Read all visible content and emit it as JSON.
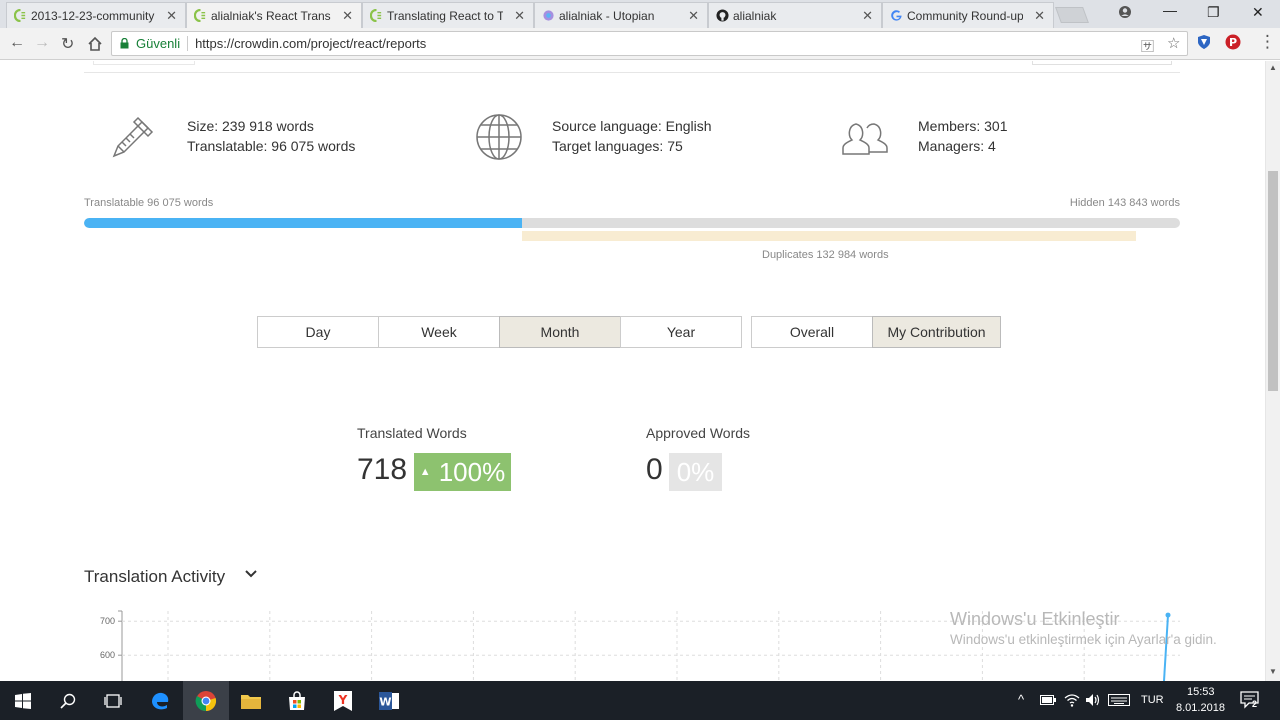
{
  "browser": {
    "tabs": [
      {
        "title": "2013-12-23-community",
        "favicon": "crowdin-icon"
      },
      {
        "title": "alialniak's React Transla",
        "favicon": "crowdin-icon",
        "active": true
      },
      {
        "title": "Translating React to Tu",
        "favicon": "crowdin-icon"
      },
      {
        "title": "alialniak - Utopian",
        "favicon": "utopian-icon"
      },
      {
        "title": "alialniak",
        "favicon": "github-icon"
      },
      {
        "title": "Community Round-up",
        "favicon": "google-icon"
      }
    ],
    "secure_label": "Güvenli",
    "url": "https://crowdin.com/project/react/reports"
  },
  "stats": {
    "size": "Size: 239 918 words",
    "translatable": "Translatable: 96 075 words",
    "source_language": "Source language: English",
    "target_languages": "Target languages: 75",
    "members": "Members: 301",
    "managers": "Managers: 4"
  },
  "progress": {
    "left_label": "Translatable 96 075 words",
    "right_label": "Hidden 143 843 words",
    "duplicates_label": "Duplicates 132 984 words",
    "translatable_fraction": 0.4
  },
  "periods": [
    "Day",
    "Week",
    "Month",
    "Year"
  ],
  "active_period": "Month",
  "scopes": [
    "Overall",
    "My Contribution"
  ],
  "active_scope": "My Contribution",
  "metrics": {
    "translated_label": "Translated Words",
    "translated_value": "718",
    "translated_pct": "100%",
    "approved_label": "Approved Words",
    "approved_value": "0",
    "approved_pct": "0%"
  },
  "section_title": "Translation Activity",
  "chart_data": {
    "type": "line",
    "y_ticks": [
      "700",
      "600"
    ],
    "ylim": [
      590,
      730
    ],
    "grid": true,
    "values": [
      718
    ]
  },
  "watermark": {
    "title": "Windows'u Etkinleştir",
    "subtitle": "Windows'u etkinleştirmek için Ayarlar'a gidin."
  },
  "taskbar": {
    "lang": "TUR",
    "time": "15:53",
    "date": "8.01.2018",
    "notifications": "2"
  }
}
